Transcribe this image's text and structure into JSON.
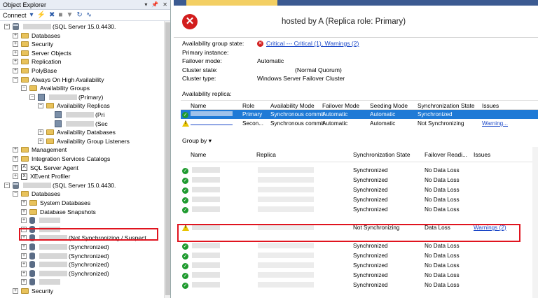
{
  "object_explorer": {
    "title": "Object Explorer",
    "connect_label": "Connect",
    "tree": [
      {
        "label": "(SQL Server 15.0.4430.",
        "level": 0,
        "icon": "server-icon",
        "expand": "-",
        "redacted": true
      },
      {
        "label": "Databases",
        "level": 1,
        "icon": "folder-icon",
        "expand": "+"
      },
      {
        "label": "Security",
        "level": 1,
        "icon": "folder-icon",
        "expand": "+"
      },
      {
        "label": "Server Objects",
        "level": 1,
        "icon": "folder-icon",
        "expand": "+"
      },
      {
        "label": "Replication",
        "level": 1,
        "icon": "folder-icon",
        "expand": "+"
      },
      {
        "label": "PolyBase",
        "level": 1,
        "icon": "folder-icon",
        "expand": "+"
      },
      {
        "label": "Always On High Availability",
        "level": 1,
        "icon": "folder-icon",
        "expand": "-"
      },
      {
        "label": "Availability Groups",
        "level": 2,
        "icon": "folder-icon",
        "expand": "-"
      },
      {
        "label": "(Primary)",
        "level": 3,
        "icon": "availability-group-icon",
        "expand": "-",
        "redacted": true
      },
      {
        "label": "Availability Replicas",
        "level": 4,
        "icon": "folder-icon",
        "expand": "-"
      },
      {
        "label": "(Pri",
        "level": 5,
        "icon": "replica-icon",
        "expand": "",
        "redacted": true
      },
      {
        "label": "(Sec",
        "level": 5,
        "icon": "replica-icon",
        "expand": "",
        "redacted": true
      },
      {
        "label": "Availability Databases",
        "level": 4,
        "icon": "folder-icon",
        "expand": "+"
      },
      {
        "label": "Availability Group Listeners",
        "level": 4,
        "icon": "folder-icon",
        "expand": "+"
      },
      {
        "label": "Management",
        "level": 1,
        "icon": "folder-icon",
        "expand": "+"
      },
      {
        "label": "Integration Services Catalogs",
        "level": 1,
        "icon": "folder-icon",
        "expand": "+"
      },
      {
        "label": "SQL Server Agent",
        "level": 1,
        "icon": "agent-icon",
        "expand": "+"
      },
      {
        "label": "XEvent Profiler",
        "level": 1,
        "icon": "xevent-icon",
        "expand": "+"
      },
      {
        "label": "(SQL Server 15.0.4430.",
        "level": 0,
        "icon": "server-icon",
        "expand": "-",
        "redacted": true
      },
      {
        "label": "Databases",
        "level": 1,
        "icon": "folder-icon",
        "expand": "-"
      },
      {
        "label": "System Databases",
        "level": 2,
        "icon": "folder-icon",
        "expand": "+"
      },
      {
        "label": "Database Snapshots",
        "level": 2,
        "icon": "folder-icon",
        "expand": "+"
      },
      {
        "label": "",
        "level": 2,
        "icon": "database-icon",
        "expand": "+",
        "redacted": true
      },
      {
        "label": "",
        "level": 2,
        "icon": "database-icon",
        "expand": "+",
        "redacted": true
      },
      {
        "label": "(Not Synchronizing / Suspect",
        "level": 2,
        "icon": "database-icon",
        "expand": "+",
        "redacted": true
      },
      {
        "label": "(Synchronized)",
        "level": 2,
        "icon": "database-icon",
        "expand": "+",
        "redacted": true
      },
      {
        "label": "(Synchronized)",
        "level": 2,
        "icon": "database-icon",
        "expand": "+",
        "redacted": true
      },
      {
        "label": "(Synchronized)",
        "level": 2,
        "icon": "database-icon",
        "expand": "+",
        "redacted": true
      },
      {
        "label": "(Synchronized)",
        "level": 2,
        "icon": "database-icon",
        "expand": "+",
        "redacted": true
      },
      {
        "label": "",
        "level": 2,
        "icon": "database-icon",
        "expand": "+",
        "redacted": true
      },
      {
        "label": "Security",
        "level": 1,
        "icon": "folder-icon",
        "expand": "+"
      }
    ]
  },
  "dashboard": {
    "header_text": "hosted by A                    (Replica role: Primary)",
    "properties": [
      {
        "key": "Availability group state:",
        "value": "Critical --- Critical (1), Warnings (2)",
        "link": true,
        "icon": "critical-icon"
      },
      {
        "key": "Primary instance:",
        "value": "",
        "link": false
      },
      {
        "key": "Failover mode:",
        "value": "Automatic",
        "link": false
      },
      {
        "key": "Cluster state:",
        "value": "(Normal Quorum)",
        "link": false
      },
      {
        "key": "Cluster type:",
        "value": "Windows Server Failover Cluster",
        "link": false
      }
    ],
    "replica_section_label": "Availability replica:",
    "replica_columns": [
      "Name",
      "Role",
      "Availability Mode",
      "Failover Mode",
      "Seeding Mode",
      "Synchronization State",
      "Issues"
    ],
    "replica_rows": [
      {
        "status": "ok",
        "name": "",
        "role": "Primary",
        "avail_mode": "Synchronous commit",
        "failover": "Automatic",
        "seeding": "Automatic",
        "sync": "Synchronized",
        "issues": "",
        "selected": true
      },
      {
        "status": "warn",
        "name": "",
        "role": "Secon...",
        "avail_mode": "Synchronous commit",
        "failover": "Automatic",
        "seeding": "Automatic",
        "sync": "Not Synchronizing",
        "issues": "Warning...",
        "selected": false
      }
    ],
    "group_by_label": "Group by",
    "db_columns": [
      "Name",
      "Replica",
      "Synchronization State",
      "Failover Readi...",
      "Issues"
    ],
    "db_rows": [
      {
        "status": "ok",
        "sync": "Synchronized",
        "failover": "No Data Loss",
        "issues": ""
      },
      {
        "status": "ok",
        "sync": "Synchronized",
        "failover": "No Data Loss",
        "issues": ""
      },
      {
        "status": "ok",
        "sync": "Synchronized",
        "failover": "No Data Loss",
        "issues": ""
      },
      {
        "status": "ok",
        "sync": "Synchronized",
        "failover": "No Data Loss",
        "issues": ""
      },
      {
        "status": "ok",
        "sync": "Synchronized",
        "failover": "No Data Loss",
        "issues": ""
      },
      {
        "status": "warn",
        "sync": "Not Synchronizing",
        "failover": "Data Loss",
        "issues": "Warnings (2)"
      },
      {
        "status": "ok",
        "sync": "Synchronized",
        "failover": "No Data Loss",
        "issues": ""
      },
      {
        "status": "ok",
        "sync": "Synchronized",
        "failover": "No Data Loss",
        "issues": ""
      },
      {
        "status": "ok",
        "sync": "Synchronized",
        "failover": "No Data Loss",
        "issues": ""
      },
      {
        "status": "ok",
        "sync": "Synchronized",
        "failover": "No Data Loss",
        "issues": ""
      },
      {
        "status": "ok",
        "sync": "Synchronized",
        "failover": "No Data Loss",
        "issues": ""
      }
    ]
  },
  "colors": {
    "selection": "#1f7ad6",
    "critical": "#d21d1d",
    "ok": "#1e9a2e",
    "warning": "#e8c400",
    "highlight_box": "#e0141f",
    "link": "#1a47c8"
  }
}
